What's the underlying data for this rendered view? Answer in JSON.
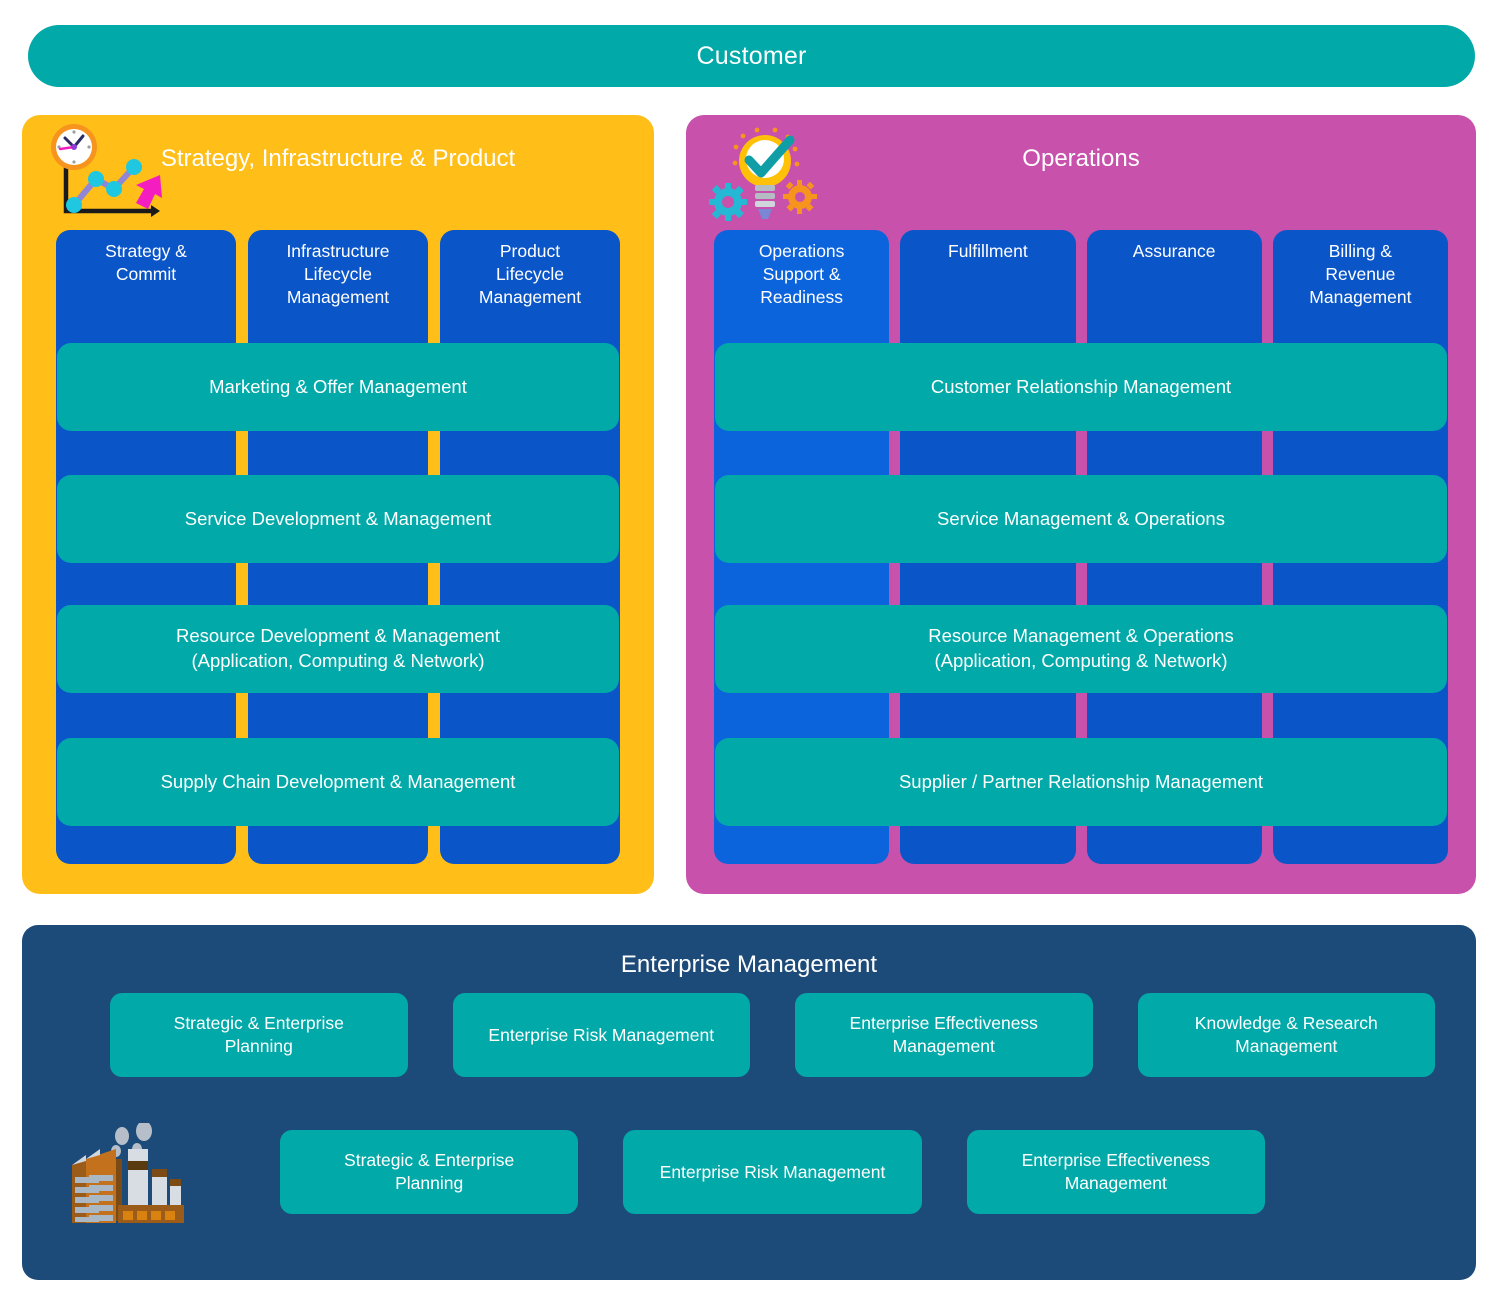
{
  "customer": {
    "label": "Customer"
  },
  "colors": {
    "customer_bar": "#02a9a9",
    "sip_panel": "#ffbe18",
    "ops_panel": "#c851ab",
    "column_blue": "#0a55c8",
    "column_blue_bright": "#0c64dd",
    "band_teal": "#02a9a9",
    "enterprise_navy": "#1d4b79",
    "text": "#ffffff"
  },
  "sip": {
    "title": "Strategy, Infrastructure & Product",
    "icon": "clock-chart-icon",
    "columns": [
      {
        "label": "Strategy &\nCommit"
      },
      {
        "label": "Infrastructure\nLifecycle\nManagement"
      },
      {
        "label": "Product\nLifecycle\nManagement"
      }
    ],
    "bands": [
      {
        "label": "Marketing & Offer Management"
      },
      {
        "label": "Service Development & Management"
      },
      {
        "label": "Resource Development & Management\n(Application, Computing & Network)"
      },
      {
        "label": "Supply Chain Development & Management"
      }
    ]
  },
  "operations": {
    "title": "Operations",
    "icon": "lightbulb-check-gears-icon",
    "columns": [
      {
        "label": "Operations\nSupport &\nReadiness"
      },
      {
        "label": "Fulfillment"
      },
      {
        "label": "Assurance"
      },
      {
        "label": "Billing &\nRevenue\nManagement"
      }
    ],
    "bands": [
      {
        "label": "Customer Relationship Management"
      },
      {
        "label": "Service Management & Operations"
      },
      {
        "label": "Resource Management & Operations\n(Application, Computing & Network)"
      },
      {
        "label": "Supplier / Partner Relationship Management"
      }
    ]
  },
  "enterprise": {
    "title": "Enterprise Management",
    "icon": "factory-icon",
    "row_1": [
      {
        "label": "Strategic & Enterprise\nPlanning"
      },
      {
        "label": "Enterprise Risk Management"
      },
      {
        "label": "Enterprise Effectiveness\nManagement"
      },
      {
        "label": "Knowledge & Research\nManagement"
      }
    ],
    "row_2": [
      {
        "label": "Strategic & Enterprise\nPlanning"
      },
      {
        "label": "Enterprise Risk Management"
      },
      {
        "label": "Enterprise Effectiveness\nManagement"
      }
    ]
  }
}
